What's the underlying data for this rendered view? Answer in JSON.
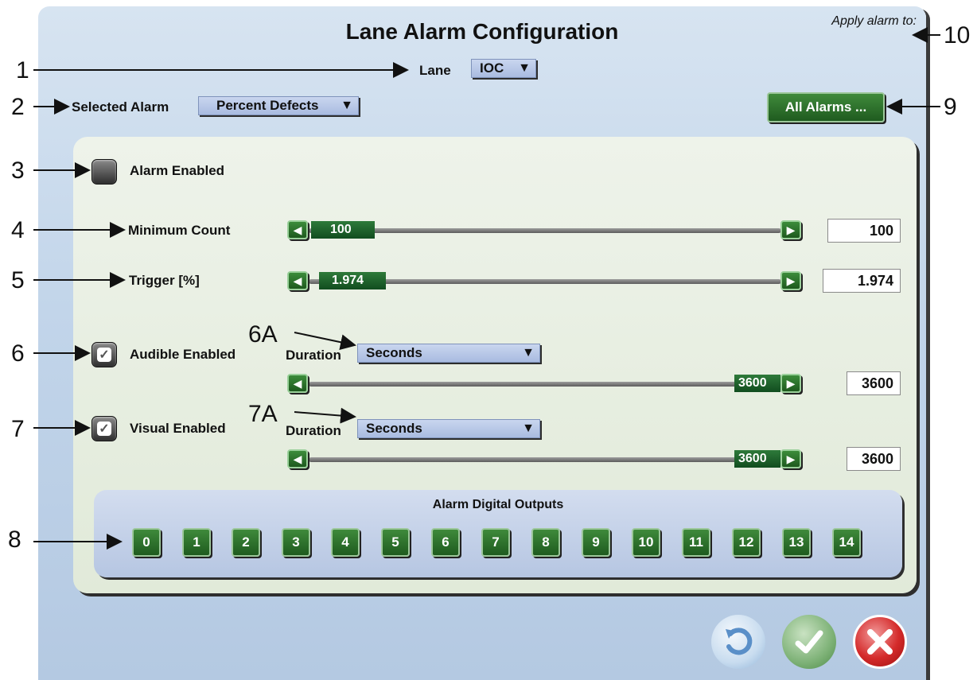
{
  "window": {
    "title": "Lane Alarm Configuration",
    "apply_label": "Apply alarm to:"
  },
  "lane": {
    "label": "Lane",
    "value": "IOC"
  },
  "selected_alarm": {
    "label": "Selected Alarm",
    "value": "Percent Defects"
  },
  "all_alarms_button": "All Alarms ...",
  "alarm_enabled": {
    "label": "Alarm Enabled",
    "checked": false
  },
  "minimum_count": {
    "label": "Minimum Count",
    "slider_value": "100",
    "box_value": "100",
    "fraction": 0.02
  },
  "trigger": {
    "label": "Trigger [%]",
    "slider_value": "1.974",
    "box_value": "1.974",
    "fraction": 0.02
  },
  "audible": {
    "label": "Audible Enabled",
    "checked": true,
    "duration_label": "Duration",
    "duration_unit": "Seconds",
    "slider_value": "3600",
    "box_value": "3600",
    "fraction": 1.0
  },
  "visual": {
    "label": "Visual Enabled",
    "checked": true,
    "duration_label": "Duration",
    "duration_unit": "Seconds",
    "slider_value": "3600",
    "box_value": "3600",
    "fraction": 1.0
  },
  "digital_outputs": {
    "title": "Alarm Digital Outputs",
    "items": [
      "0",
      "1",
      "2",
      "3",
      "4",
      "5",
      "6",
      "7",
      "8",
      "9",
      "10",
      "11",
      "12",
      "13",
      "14"
    ]
  },
  "annotations": [
    "1",
    "2",
    "3",
    "4",
    "5",
    "6",
    "7",
    "8",
    "9",
    "10",
    "6A",
    "7A"
  ],
  "icons": {
    "undo": "undo-icon",
    "accept": "check-icon",
    "cancel": "close-icon"
  },
  "colors": {
    "accent_green": "#1f5b1f",
    "cancel_red": "#c41616",
    "accept_green": "#5b9a53",
    "undo_blue": "#7fa9d6"
  }
}
